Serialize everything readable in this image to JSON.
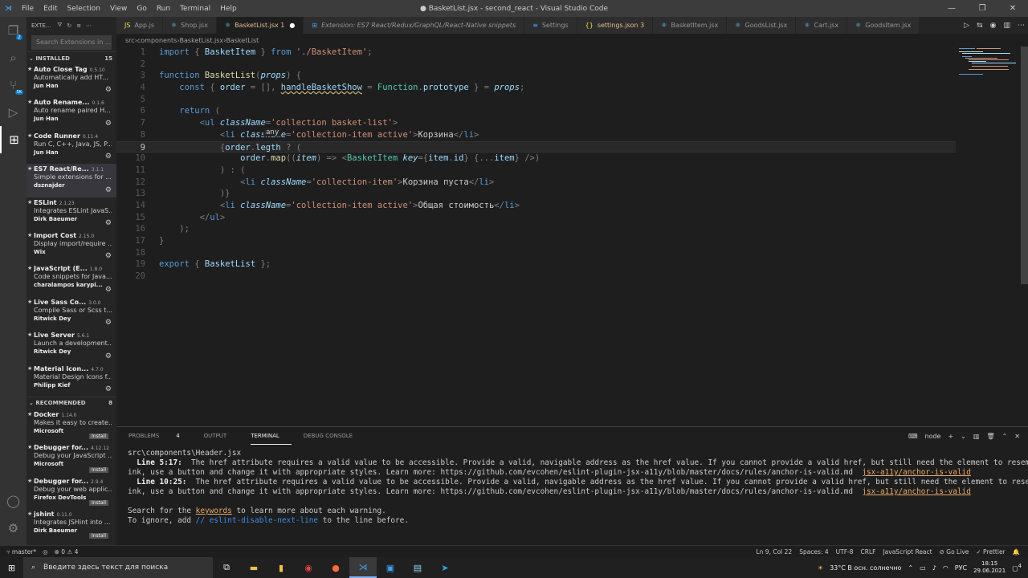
{
  "window": {
    "title": "● BasketList.jsx - second_react - Visual Studio Code",
    "menu": [
      "File",
      "Edit",
      "Selection",
      "View",
      "Go",
      "Run",
      "Terminal",
      "Help"
    ]
  },
  "sidebar": {
    "header": "EXTE...",
    "search_placeholder": "Search Extensions in ...",
    "installed_label": "INSTALLED",
    "installed_count": "15",
    "recommended_label": "RECOMMENDED",
    "recommended_count": "8",
    "installed": [
      {
        "name": "Auto Close Tag",
        "ver": "0.5.10",
        "desc": "Automatically add HT...",
        "author": "Jun Han"
      },
      {
        "name": "Auto Rename...",
        "ver": "0.1.6",
        "desc": "Auto rename paired H...",
        "author": "Jun Han"
      },
      {
        "name": "Code Runner",
        "ver": "0.11.4",
        "desc": "Run C, C++, Java, JS, P...",
        "author": "Jun Han"
      },
      {
        "name": "ES7 React/Re...",
        "ver": "3.1.1",
        "desc": "Simple extensions for ...",
        "author": "dsznajder"
      },
      {
        "name": "ESLint",
        "ver": "2.1.23",
        "desc": "Integrates ESLint JavaS...",
        "author": "Dirk Baeumer"
      },
      {
        "name": "Import Cost",
        "ver": "2.15.0",
        "desc": "Display import/require ...",
        "author": "Wix"
      },
      {
        "name": "JavaScript (E...",
        "ver": "1.8.0",
        "desc": "Code snippets for Java...",
        "author": "charalampos karypi..."
      },
      {
        "name": "Live Sass Co...",
        "ver": "3.0.0",
        "desc": "Compile Sass or Scss t...",
        "author": "Ritwick Dey"
      },
      {
        "name": "Live Server",
        "ver": "5.6.1",
        "desc": "Launch a development...",
        "author": "Ritwick Dey"
      },
      {
        "name": "Material Icon...",
        "ver": "4.7.0",
        "desc": "Material Design Icons f...",
        "author": "Philipp Kief"
      }
    ],
    "recommended": [
      {
        "name": "Docker",
        "ver": "1.14.0",
        "desc": "Makes it easy to create...",
        "author": "Microsoft",
        "btn": "Install"
      },
      {
        "name": "Debugger for...",
        "ver": "4.12.12",
        "desc": "Debug your JavaScript ...",
        "author": "Microsoft",
        "btn": "Install"
      },
      {
        "name": "Debugger for...",
        "ver": "2.9.4",
        "desc": "Debug your web applic...",
        "author": "Firefox DevTools",
        "btn": "Install"
      },
      {
        "name": "jshint",
        "ver": "0.11.0",
        "desc": "Integrates JSHint into ...",
        "author": "Dirk Baeumer",
        "btn": "Install"
      }
    ]
  },
  "tabs": [
    {
      "label": "App.js",
      "icon": "js"
    },
    {
      "label": "Shop.jsx",
      "icon": "react"
    },
    {
      "label": "BasketList.jsx 1",
      "icon": "react",
      "active": true,
      "dirty": "●"
    },
    {
      "label": "Extension: ES7 React/Redux/GraphQL/React-Native snippets",
      "icon": "ext"
    },
    {
      "label": "Settings",
      "icon": "settings"
    },
    {
      "label": "settings.json 3",
      "icon": "json"
    },
    {
      "label": "BasketItem.jsx",
      "icon": "react"
    },
    {
      "label": "GoodsList.jsx",
      "icon": "react"
    },
    {
      "label": "Cart.jsx",
      "icon": "react"
    },
    {
      "label": "GoodsItem.jsx",
      "icon": "react"
    }
  ],
  "breadcrumb": [
    "src",
    "components",
    "BasketList.jsx",
    "BasketList"
  ],
  "hover": "any",
  "panel": {
    "tabs": [
      "PROBLEMS",
      "OUTPUT",
      "TERMINAL",
      "DEBUG CONSOLE"
    ],
    "problems_count": "4",
    "active_tab": "TERMINAL",
    "shell": "node",
    "lines": {
      "path": "src\\components\\Header.jsx",
      "l1a": "  Line 5:17:",
      "l1b": "  The href attribute requires a valid value to be accessible. Provide a valid, navigable address as the href value. If you cannot provide a valid href, but still need the element to resemble a l",
      "l2": "ink, use a button and change it with appropriate styles. Learn more: https://github.com/evcohen/eslint-plugin-jsx-a11y/blob/master/docs/rules/anchor-is-valid.md  ",
      "rule": "jsx-a11y/anchor-is-valid",
      "l3a": "  Line 10:25:",
      "l3b": "  The href attribute requires a valid value to be accessible. Provide a valid, navigable address as the href value. If you cannot provide a valid href, but still need the element to resemble a l",
      "l4": "ink, use a button and change it with appropriate styles. Learn more: https://github.com/evcohen/eslint-plugin-jsx-a11y/blob/master/docs/rules/anchor-is-valid.md  ",
      "s1a": "Search for the ",
      "s1k": "keywords",
      "s1b": " to learn more about each warning.",
      "s2a": "To ignore, add ",
      "s2c": "// eslint-disable-next-line",
      "s2b": " to the line before."
    }
  },
  "status": {
    "branch": "master*",
    "problems": "⊗ 0 ⚠ 4",
    "right": [
      "Ln 9, Col 22",
      "Spaces: 4",
      "UTF-8",
      "CRLF",
      "JavaScript React",
      "⊘ Go Live",
      "✓ Prettier"
    ]
  },
  "taskbar": {
    "search": "Введите здесь текст для поиска",
    "weather": "33°C  В осн. солнечно",
    "lang": "РУС",
    "time": "18:15",
    "date": "29.06.2021",
    "notif": "4"
  }
}
